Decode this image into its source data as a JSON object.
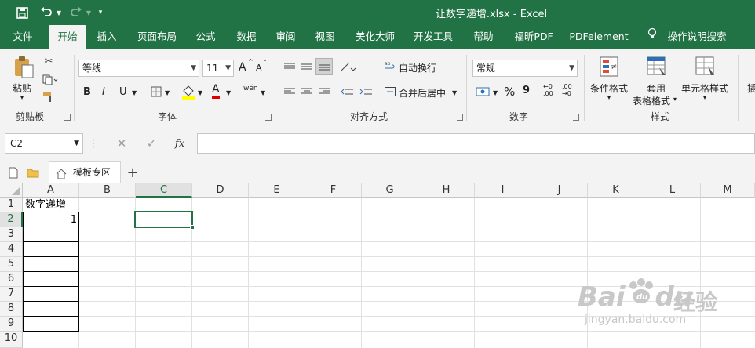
{
  "window": {
    "title": "让数字递增.xlsx  -  Excel"
  },
  "qat": {
    "save_icon": "save-icon",
    "undo_icon": "undo-icon",
    "redo_icon": "redo-icon",
    "customize_icon": "customize-icon"
  },
  "menu": {
    "tabs": [
      "文件",
      "开始",
      "插入",
      "页面布局",
      "公式",
      "数据",
      "审阅",
      "视图",
      "美化大师",
      "开发工具",
      "帮助",
      "福昕PDF",
      "PDFelement",
      "操作说明搜索"
    ],
    "active": "开始"
  },
  "ribbon": {
    "clipboard": {
      "paste": "粘贴",
      "label": "剪贴板"
    },
    "font": {
      "name": "等线",
      "size": "11",
      "grow": "A",
      "shrink": "A",
      "bold": "B",
      "italic": "I",
      "underline": "U",
      "color_letter": "A",
      "wen": "wén",
      "label": "字体"
    },
    "align": {
      "wrap": "自动换行",
      "merge": "合并后居中",
      "label": "对齐方式"
    },
    "number": {
      "format": "常规",
      "percent": "%",
      "comma": "9",
      "inc": "←0 .00",
      "dec": ".00 →0",
      "label": "数字"
    },
    "styles": {
      "cond": "条件格式",
      "table_a": "套用",
      "table_b": "表格格式",
      "cell": "单元格样式",
      "label": "样式"
    },
    "edit_partial": "插"
  },
  "formula": {
    "name_box": "C2",
    "fx": "fx",
    "value": ""
  },
  "docbar": {
    "tab": "模板专区",
    "add": "+"
  },
  "sheet": {
    "columns": [
      "A",
      "B",
      "C",
      "D",
      "E",
      "F",
      "G",
      "H",
      "I",
      "J",
      "K",
      "L",
      "M"
    ],
    "rows": [
      "1",
      "2",
      "3",
      "4",
      "5",
      "6",
      "7",
      "8",
      "9",
      "10"
    ],
    "selected_column": "C",
    "selected_row": "2",
    "cells": {
      "A1": "数字递增",
      "A2": "1"
    }
  },
  "watermark": {
    "brand": "Bai",
    "brand2": "du",
    "suffix": "经验",
    "url": "jingyan.baidu.com"
  },
  "colors": {
    "accent": "#217346",
    "ribbon": "#f3f3f3"
  }
}
